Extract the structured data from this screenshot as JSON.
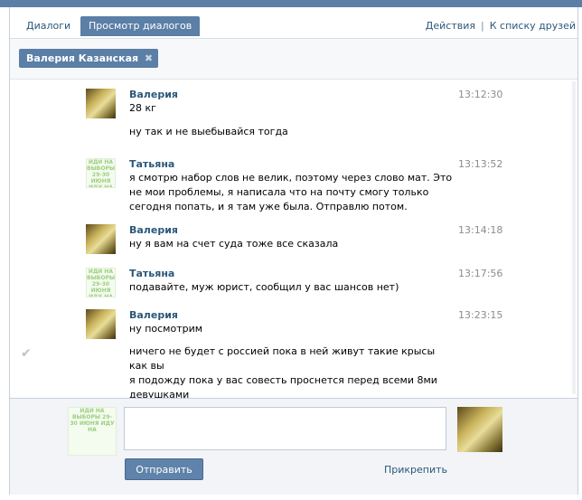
{
  "tabs": [
    {
      "label": "Диалоги",
      "active": false
    },
    {
      "label": "Просмотр диалогов",
      "active": true
    }
  ],
  "top_links": {
    "actions": "Действия",
    "separator": "|",
    "friends": "К списку друзей"
  },
  "peer": {
    "name": "Валерия Казанская",
    "close_symbol": "✖"
  },
  "messages": [
    {
      "author": "Валерия",
      "avatar": "photo",
      "time": "13:12:30",
      "lines": [
        "28 кг",
        "",
        "ну так и не выебывайся тогда"
      ]
    },
    {
      "author": "Татьяна",
      "avatar": "text-banner",
      "time": "13:13:52",
      "lines": [
        "я смотрю набор слов не велик, поэтому через слово мат. Это не мои проблемы, я написала что на почту смогу только сегодня попать, и я там уже была. Отправлю потом."
      ]
    },
    {
      "author": "Валерия",
      "avatar": "photo",
      "time": "13:14:18",
      "lines": [
        "ну я вам на счет суда тоже все сказала"
      ]
    },
    {
      "author": "Татьяна",
      "avatar": "text-banner",
      "time": "13:17:56",
      "lines": [
        "подавайте, муж юрист, сообщил у вас шансов нет)"
      ]
    },
    {
      "author": "Валерия",
      "avatar": "photo",
      "time": "13:23:15",
      "lines": [
        "ну посмотрим",
        "",
        "ничего не будет с россией пока в ней живут такие крысы как вы",
        "",
        "я подожду пока у вас совесть проснется перед всеми 8ми девушками"
      ]
    }
  ],
  "read_check_icon": "✔",
  "avatar_banner_text": "ИДИ НА ВЫБОРЫ 29-30 ИЮНЯ ИДУ НА",
  "composer": {
    "input_value": "",
    "send_label": "Отправить",
    "attach_label": "Прикрепить"
  }
}
